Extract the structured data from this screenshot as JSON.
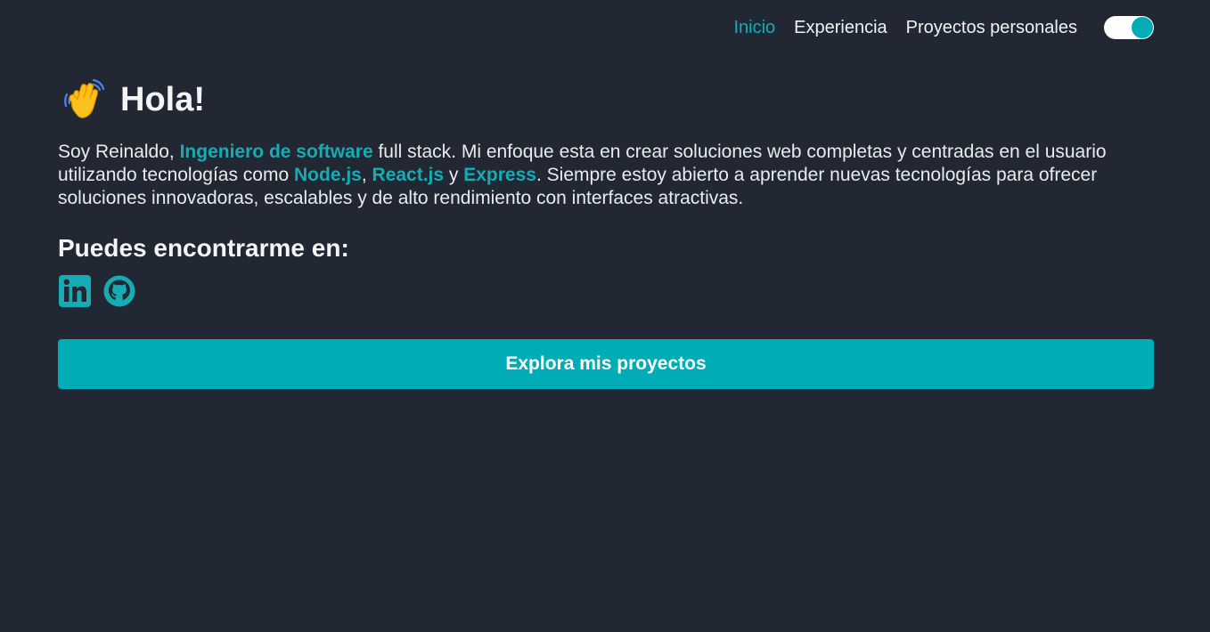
{
  "nav": {
    "items": [
      {
        "label": "Inicio",
        "active": true
      },
      {
        "label": "Experiencia",
        "active": false
      },
      {
        "label": "Proyectos personales",
        "active": false
      }
    ],
    "theme_toggle_on": true
  },
  "hero": {
    "title": "Hola!",
    "intro": {
      "p1": "Soy Reinaldo, ",
      "role": "Ingeniero de software",
      "p2": " full stack. Mi enfoque esta en crear soluciones web completas y centradas en el usuario utilizando tecnologías como ",
      "tech1": "Node.js",
      "sep1": ", ",
      "tech2": "React.js",
      "sep2": " y ",
      "tech3": "Express",
      "p3": ". Siempre estoy abierto a aprender nuevas tecnologías para ofrecer soluciones innovadoras, escalables y de alto rendimiento con interfaces atractivas."
    },
    "find_heading": "Puedes encontrarme en:",
    "socials": [
      {
        "icon": "linkedin-icon"
      },
      {
        "icon": "github-icon"
      }
    ],
    "cta_label": "Explora mis proyectos"
  },
  "colors": {
    "background": "#222833",
    "accent": "#00acb5"
  }
}
